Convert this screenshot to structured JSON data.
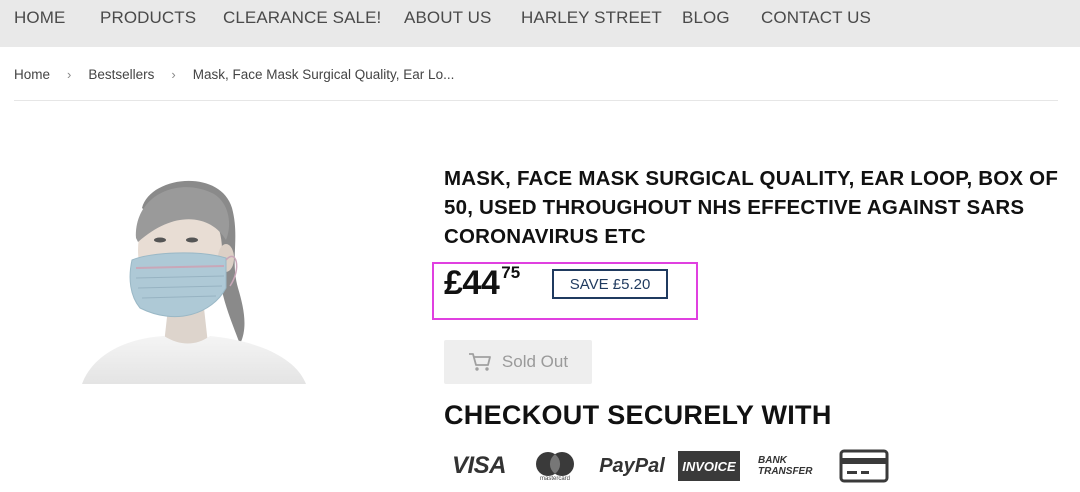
{
  "nav": {
    "items": [
      "HOME",
      "PRODUCTS",
      "CLEARANCE SALE!",
      "ABOUT US",
      "HARLEY STREET",
      "BLOG",
      "CONTACT US"
    ]
  },
  "breadcrumb": {
    "home": "Home",
    "category": "Bestsellers",
    "current": "Mask, Face Mask Surgical Quality, Ear Lo..."
  },
  "product": {
    "title": "MASK, FACE MASK SURGICAL QUALITY, EAR LOOP, BOX OF 50, USED THROUGHOUT NHS EFFECTIVE AGAINST SARS CORONAVIRUS ETC",
    "price_main": "£44",
    "price_cents": "75",
    "save_label": "SAVE £5.20",
    "sold_out_label": "Sold Out"
  },
  "checkout": {
    "heading": "CHECKOUT SECURELY WITH",
    "methods": {
      "visa": "VISA",
      "mastercard": "mastercard",
      "paypal": "PayPal",
      "invoice": "INVOICE",
      "bank_line1": "BANK",
      "bank_line2": "TRANSFER"
    }
  },
  "colors": {
    "nav_bg": "#e9e9e9",
    "highlight_border": "#e040e0",
    "badge_color": "#1f3a5f",
    "soldout_bg": "#eeeeee"
  },
  "icons": [
    "cart-icon",
    "mastercard-icon",
    "card-icon"
  ]
}
